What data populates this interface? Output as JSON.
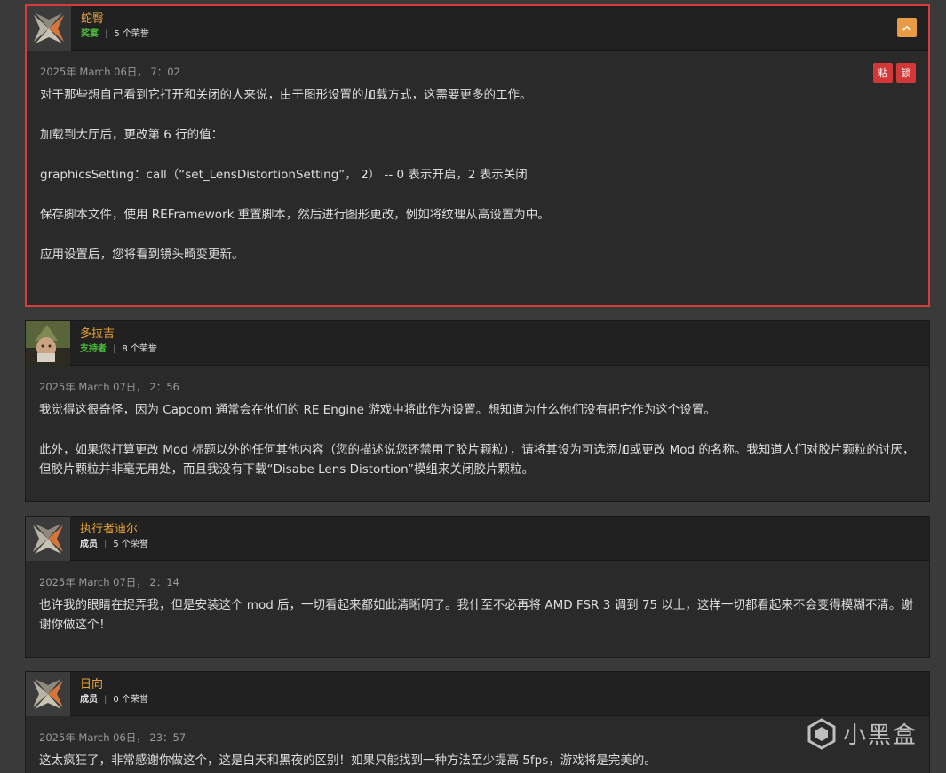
{
  "posts": [
    {
      "username": "蛇臀",
      "rank": "奖宴",
      "kudos": "5 个荣誉",
      "timestamp": "2025年 March 06日， 7：02",
      "mod_sticky": "粘",
      "mod_lock": "锁",
      "paragraphs": [
        "对于那些想自己看到它打开和关闭的人来说，由于图形设置的加载方式，这需要更多的工作。",
        "加载到大厅后，更改第 6 行的值：",
        "graphicsSetting：call（“set_LensDistortionSetting”， 2） -- 0 表示开启，2 表示关闭",
        "保存脚本文件，使用 REFramework 重置脚本，然后进行图形更改，例如将纹理从高设置为中。",
        "应用设置后，您将看到镜头畸变更新。"
      ]
    },
    {
      "username": "多拉吉",
      "rank": "支持者",
      "kudos": "8 个荣誉",
      "timestamp": "2025年 March 07日， 2：56",
      "paragraphs": [
        "我觉得这很奇怪，因为 Capcom 通常会在他们的 RE Engine 游戏中将此作为设置。想知道为什么他们没有把它作为这个设置。",
        "此外，如果您打算更改 Mod 标题以外的任何其他内容（您的描述说您还禁用了胶片颗粒），请将其设为可选添加或更改 Mod 的名称。我知道人们对胶片颗粒的讨厌，但胶片颗粒并非毫无用处，而且我没有下载“Disabe Lens Distortion”模组来关闭胶片颗粒。"
      ]
    },
    {
      "username": "执行者迪尔",
      "rank": "成员",
      "kudos": "5 个荣誉",
      "timestamp": "2025年 March 07日， 2：14",
      "paragraphs": [
        "也许我的眼睛在捉弄我，但是安装这个 mod 后，一切看起来都如此清晰明了。我什至不必再将 AMD FSR 3 调到 75 以上，这样一切都看起来不会变得模糊不清。谢谢你做这个！"
      ]
    },
    {
      "username": "日向",
      "rank": "成员",
      "kudos": "0 个荣誉",
      "timestamp": "2025年 March 06日， 23：57",
      "paragraphs": [
        "这太疯狂了，非常感谢你做这个，这是白天和黑夜的区别！如果只能找到一种方法至少提高 5fps，游戏将是完美的。"
      ]
    }
  ],
  "watermark": {
    "text": "小黑盒"
  },
  "colors": {
    "username": "#e8a33a",
    "rank_green": "#4cbd3c",
    "highlight_border": "#d93a3a",
    "mod_button": "#d43737",
    "top_button": "#e89a44"
  },
  "icons": {
    "avatar_default": "default-avatar-icon",
    "top_button": "chevron-up-icon",
    "watermark": "heybox-logo-icon"
  }
}
